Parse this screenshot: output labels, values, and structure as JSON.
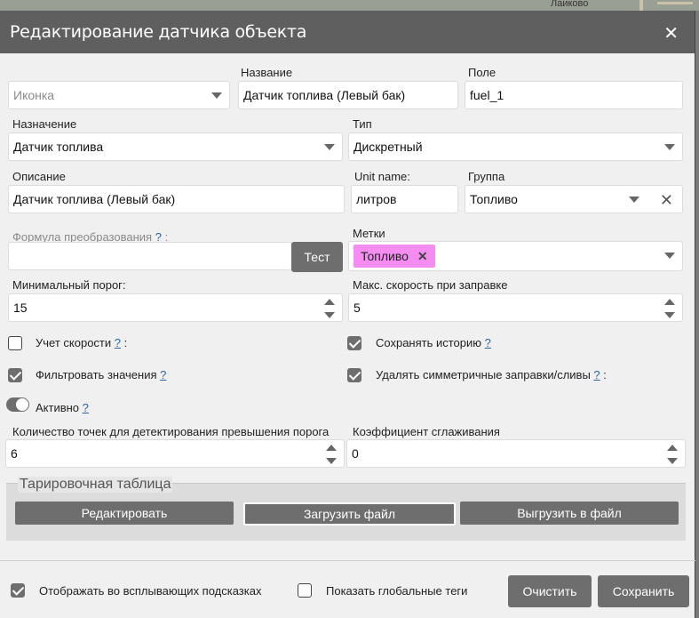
{
  "map": {
    "place_label": "Лаиково"
  },
  "dialog": {
    "title": "Редактирование датчика объекта",
    "close_icon": "close-icon"
  },
  "fields": {
    "icon": {
      "value": "Иконка"
    },
    "name": {
      "label": "Название",
      "value": "Датчик топлива (Левый бак)"
    },
    "field": {
      "label": "Поле",
      "value": "fuel_1"
    },
    "purpose": {
      "label": "Назначение",
      "value": "Датчик топлива"
    },
    "type": {
      "label": "Тип",
      "value": "Дискретный"
    },
    "description": {
      "label": "Описание",
      "value": "Датчик топлива (Левый бак)"
    },
    "unit": {
      "label": "Unit name:",
      "value": "литров"
    },
    "group": {
      "label": "Группа",
      "value": "Топливо"
    },
    "formula": {
      "label": "Формула преобразования",
      "help": "?",
      "suffix": ":",
      "value": "",
      "test_button": "Тест"
    },
    "tags": {
      "label": "Метки",
      "items": [
        "Топливо"
      ]
    },
    "min_threshold": {
      "label": "Минимальный порог:",
      "value": "15"
    },
    "max_speed": {
      "label": "Макс. скорость при заправке",
      "value": "5"
    },
    "points_count": {
      "label": "Количество точек для детектирования превышения порога",
      "value": "6"
    },
    "smoothing": {
      "label": "Коэффициент сглаживания",
      "value": "0"
    }
  },
  "checkboxes": {
    "speed": {
      "label": "Учет скорости",
      "help": "?",
      "suffix": ":",
      "checked": false
    },
    "save_history": {
      "label": "Сохранять историю",
      "help": "?",
      "checked": true
    },
    "filter": {
      "label": "Фильтровать значения",
      "help": "?",
      "checked": true
    },
    "symmetric": {
      "label": "Удалять симметричные заправки/сливы",
      "help": "?",
      "suffix": ":",
      "checked": true
    },
    "active": {
      "label": "Активно",
      "help": "?",
      "on": true
    }
  },
  "calibration": {
    "legend": "Тарировочная таблица",
    "edit": "Редактировать",
    "upload": "Загрузить файл",
    "download": "Выгрузить в файл"
  },
  "footer": {
    "show_tooltips": {
      "label": "Отображать во всплывающих подсказках",
      "checked": true
    },
    "global_tags": {
      "label": "Показать глобальные теги",
      "checked": false
    },
    "clear": "Очистить",
    "save": "Сохранить"
  }
}
